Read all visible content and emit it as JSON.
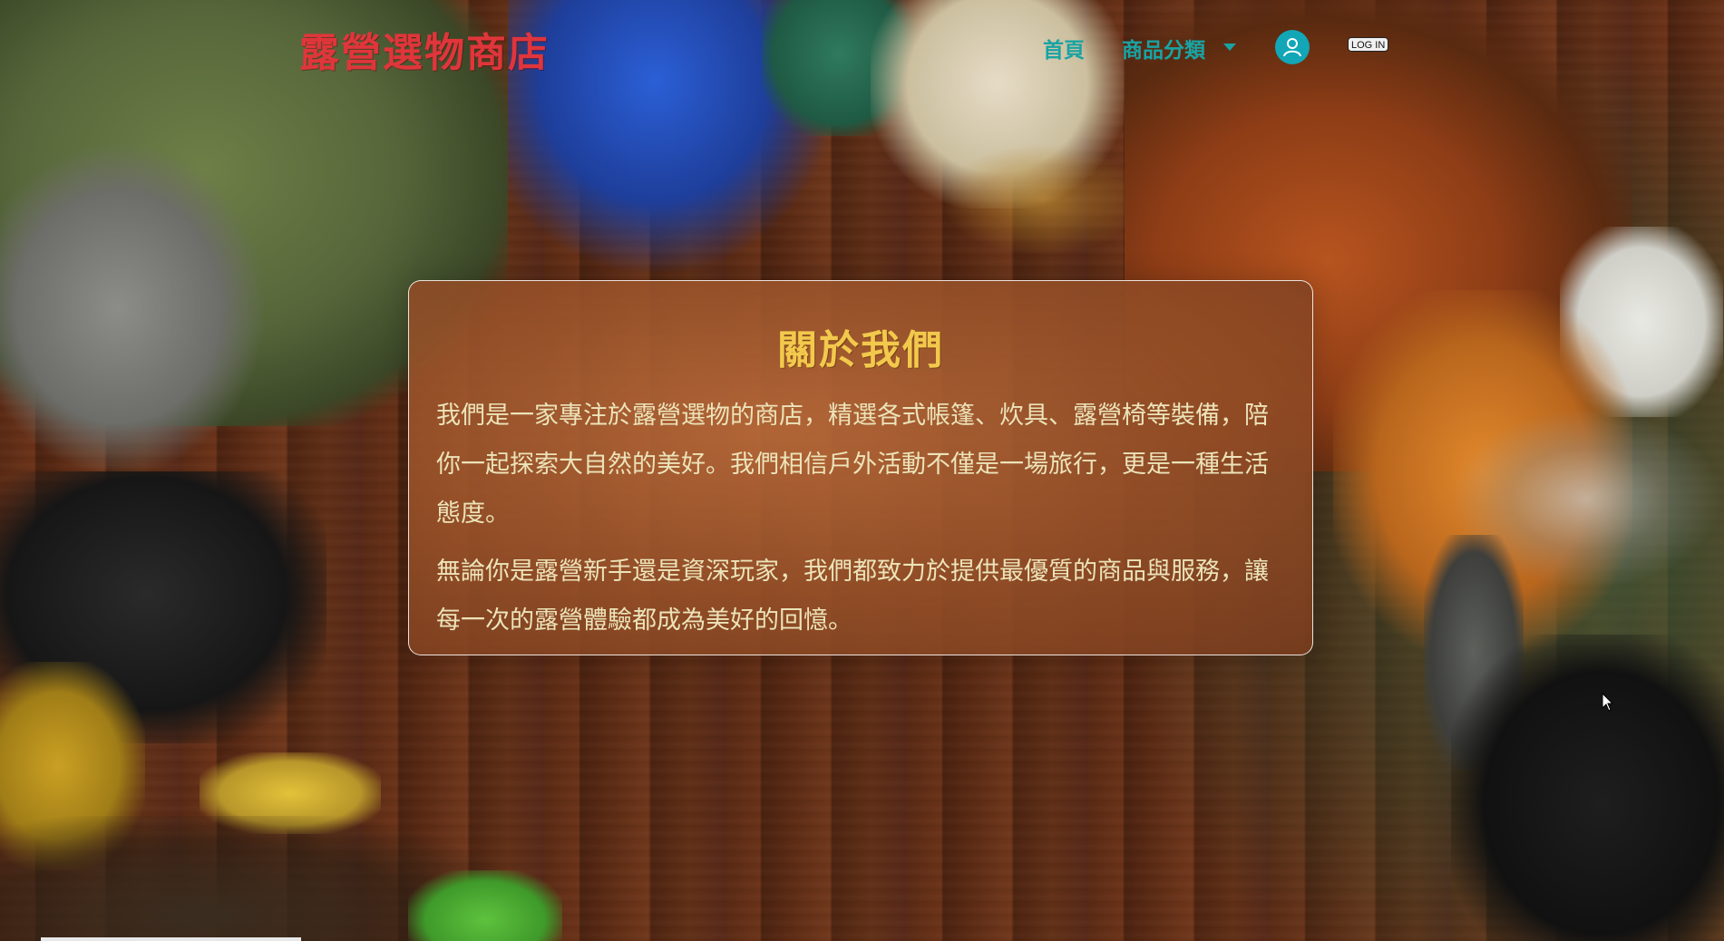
{
  "navbar": {
    "brand": "露營選物商店",
    "home_label": "首頁",
    "category_label": "商品分類",
    "login_label": "LOG IN",
    "user_icon": "user-circle-icon"
  },
  "about": {
    "title": "關於我們",
    "paragraphs": [
      "我們是一家專注於露營選物的商店，精選各式帳篷、炊具、露營椅等裝備，陪你一起探索大自然的美好。我們相信戶外活動不僅是一場旅行，更是一種生活態度。",
      "無論你是露營新手還是資深玩家，我們都致力於提供最優質的商品與服務，讓每一次的露營體驗都成為美好的回憶。"
    ]
  },
  "colors": {
    "brand": "#e0353b",
    "nav_link": "#19a3a3",
    "title": "#f2c94c",
    "body_text": "#ece3b9",
    "user_icon_bg": "#12a6b7"
  }
}
